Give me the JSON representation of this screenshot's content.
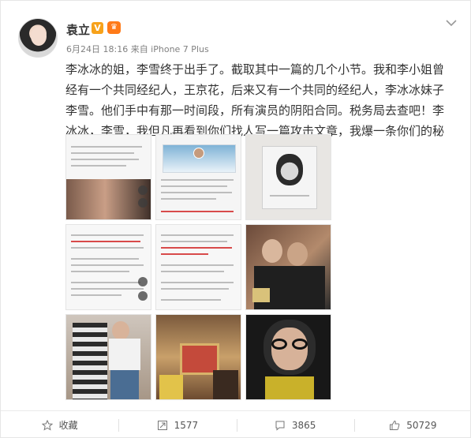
{
  "post": {
    "author": "袁立",
    "verified_badge": "V",
    "member_badge": "♛",
    "meta": "6月24日 18:16 来自 iPhone 7 Plus",
    "text": "李冰冰的姐，李雪终于出手了。截取其中一篇的几个小节。我和李小姐曾经有一个共同经纪人，王京花，后来又有一个共同的经纪人，李冰冰妹子李雪。他们手中有那一时间段，所有演员的阴阳合同。税务局去查吧！李冰冰，李雪，我但凡再看到你们找人写一篇攻击文章，我爆一条你们的秘密！"
  },
  "images": [
    {
      "id": "img-1",
      "kind": "document-screenshot"
    },
    {
      "id": "img-2",
      "kind": "profile-screenshot"
    },
    {
      "id": "img-3",
      "kind": "portrait-photo"
    },
    {
      "id": "img-4",
      "kind": "document-screenshot"
    },
    {
      "id": "img-5",
      "kind": "document-screenshot"
    },
    {
      "id": "img-6",
      "kind": "group-photo"
    },
    {
      "id": "img-7",
      "kind": "couple-photo"
    },
    {
      "id": "img-8",
      "kind": "interior-photo"
    },
    {
      "id": "img-9",
      "kind": "portrait-with-glasses"
    }
  ],
  "footer": {
    "favorite_label": "收藏",
    "repost_count": "1577",
    "comment_count": "3865",
    "like_count": "50729"
  },
  "colors": {
    "accent": "#f7a21b",
    "link": "#eb7350",
    "text": "#333333",
    "muted": "#808080"
  }
}
